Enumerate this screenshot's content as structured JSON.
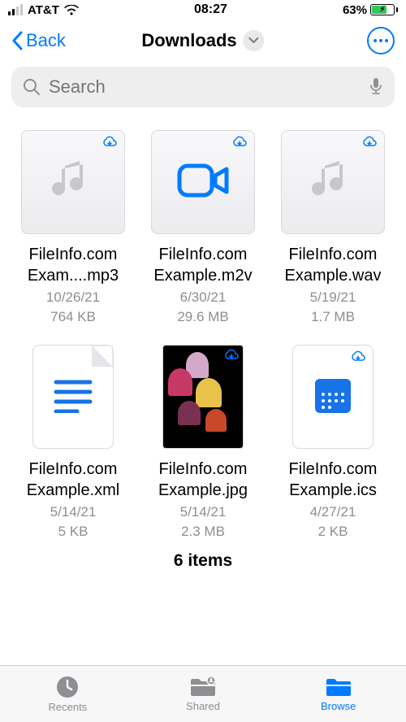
{
  "status": {
    "carrier": "AT&T",
    "time": "08:27",
    "battery_pct": "63%"
  },
  "nav": {
    "back_label": "Back",
    "title": "Downloads"
  },
  "search": {
    "placeholder": "Search"
  },
  "files": [
    {
      "name_l1": "FileInfo.com",
      "name_l2": "Exam....mp3",
      "date": "10/26/21",
      "size": "764 KB",
      "icon": "music",
      "cloud": true
    },
    {
      "name_l1": "FileInfo.com",
      "name_l2": "Example.m2v",
      "date": "6/30/21",
      "size": "29.6 MB",
      "icon": "video",
      "cloud": true
    },
    {
      "name_l1": "FileInfo.com",
      "name_l2": "Example.wav",
      "date": "5/19/21",
      "size": "1.7 MB",
      "icon": "music",
      "cloud": true
    },
    {
      "name_l1": "FileInfo.com",
      "name_l2": "Example.xml",
      "date": "5/14/21",
      "size": "5 KB",
      "icon": "doc",
      "cloud": false
    },
    {
      "name_l1": "FileInfo.com",
      "name_l2": "Example.jpg",
      "date": "5/14/21",
      "size": "2.3 MB",
      "icon": "photo",
      "cloud": true
    },
    {
      "name_l1": "FileInfo.com",
      "name_l2": "Example.ics",
      "date": "4/27/21",
      "size": "2 KB",
      "icon": "calendar",
      "cloud": true
    }
  ],
  "summary": "6 items",
  "tabs": {
    "recents": "Recents",
    "shared": "Shared",
    "browse": "Browse"
  }
}
